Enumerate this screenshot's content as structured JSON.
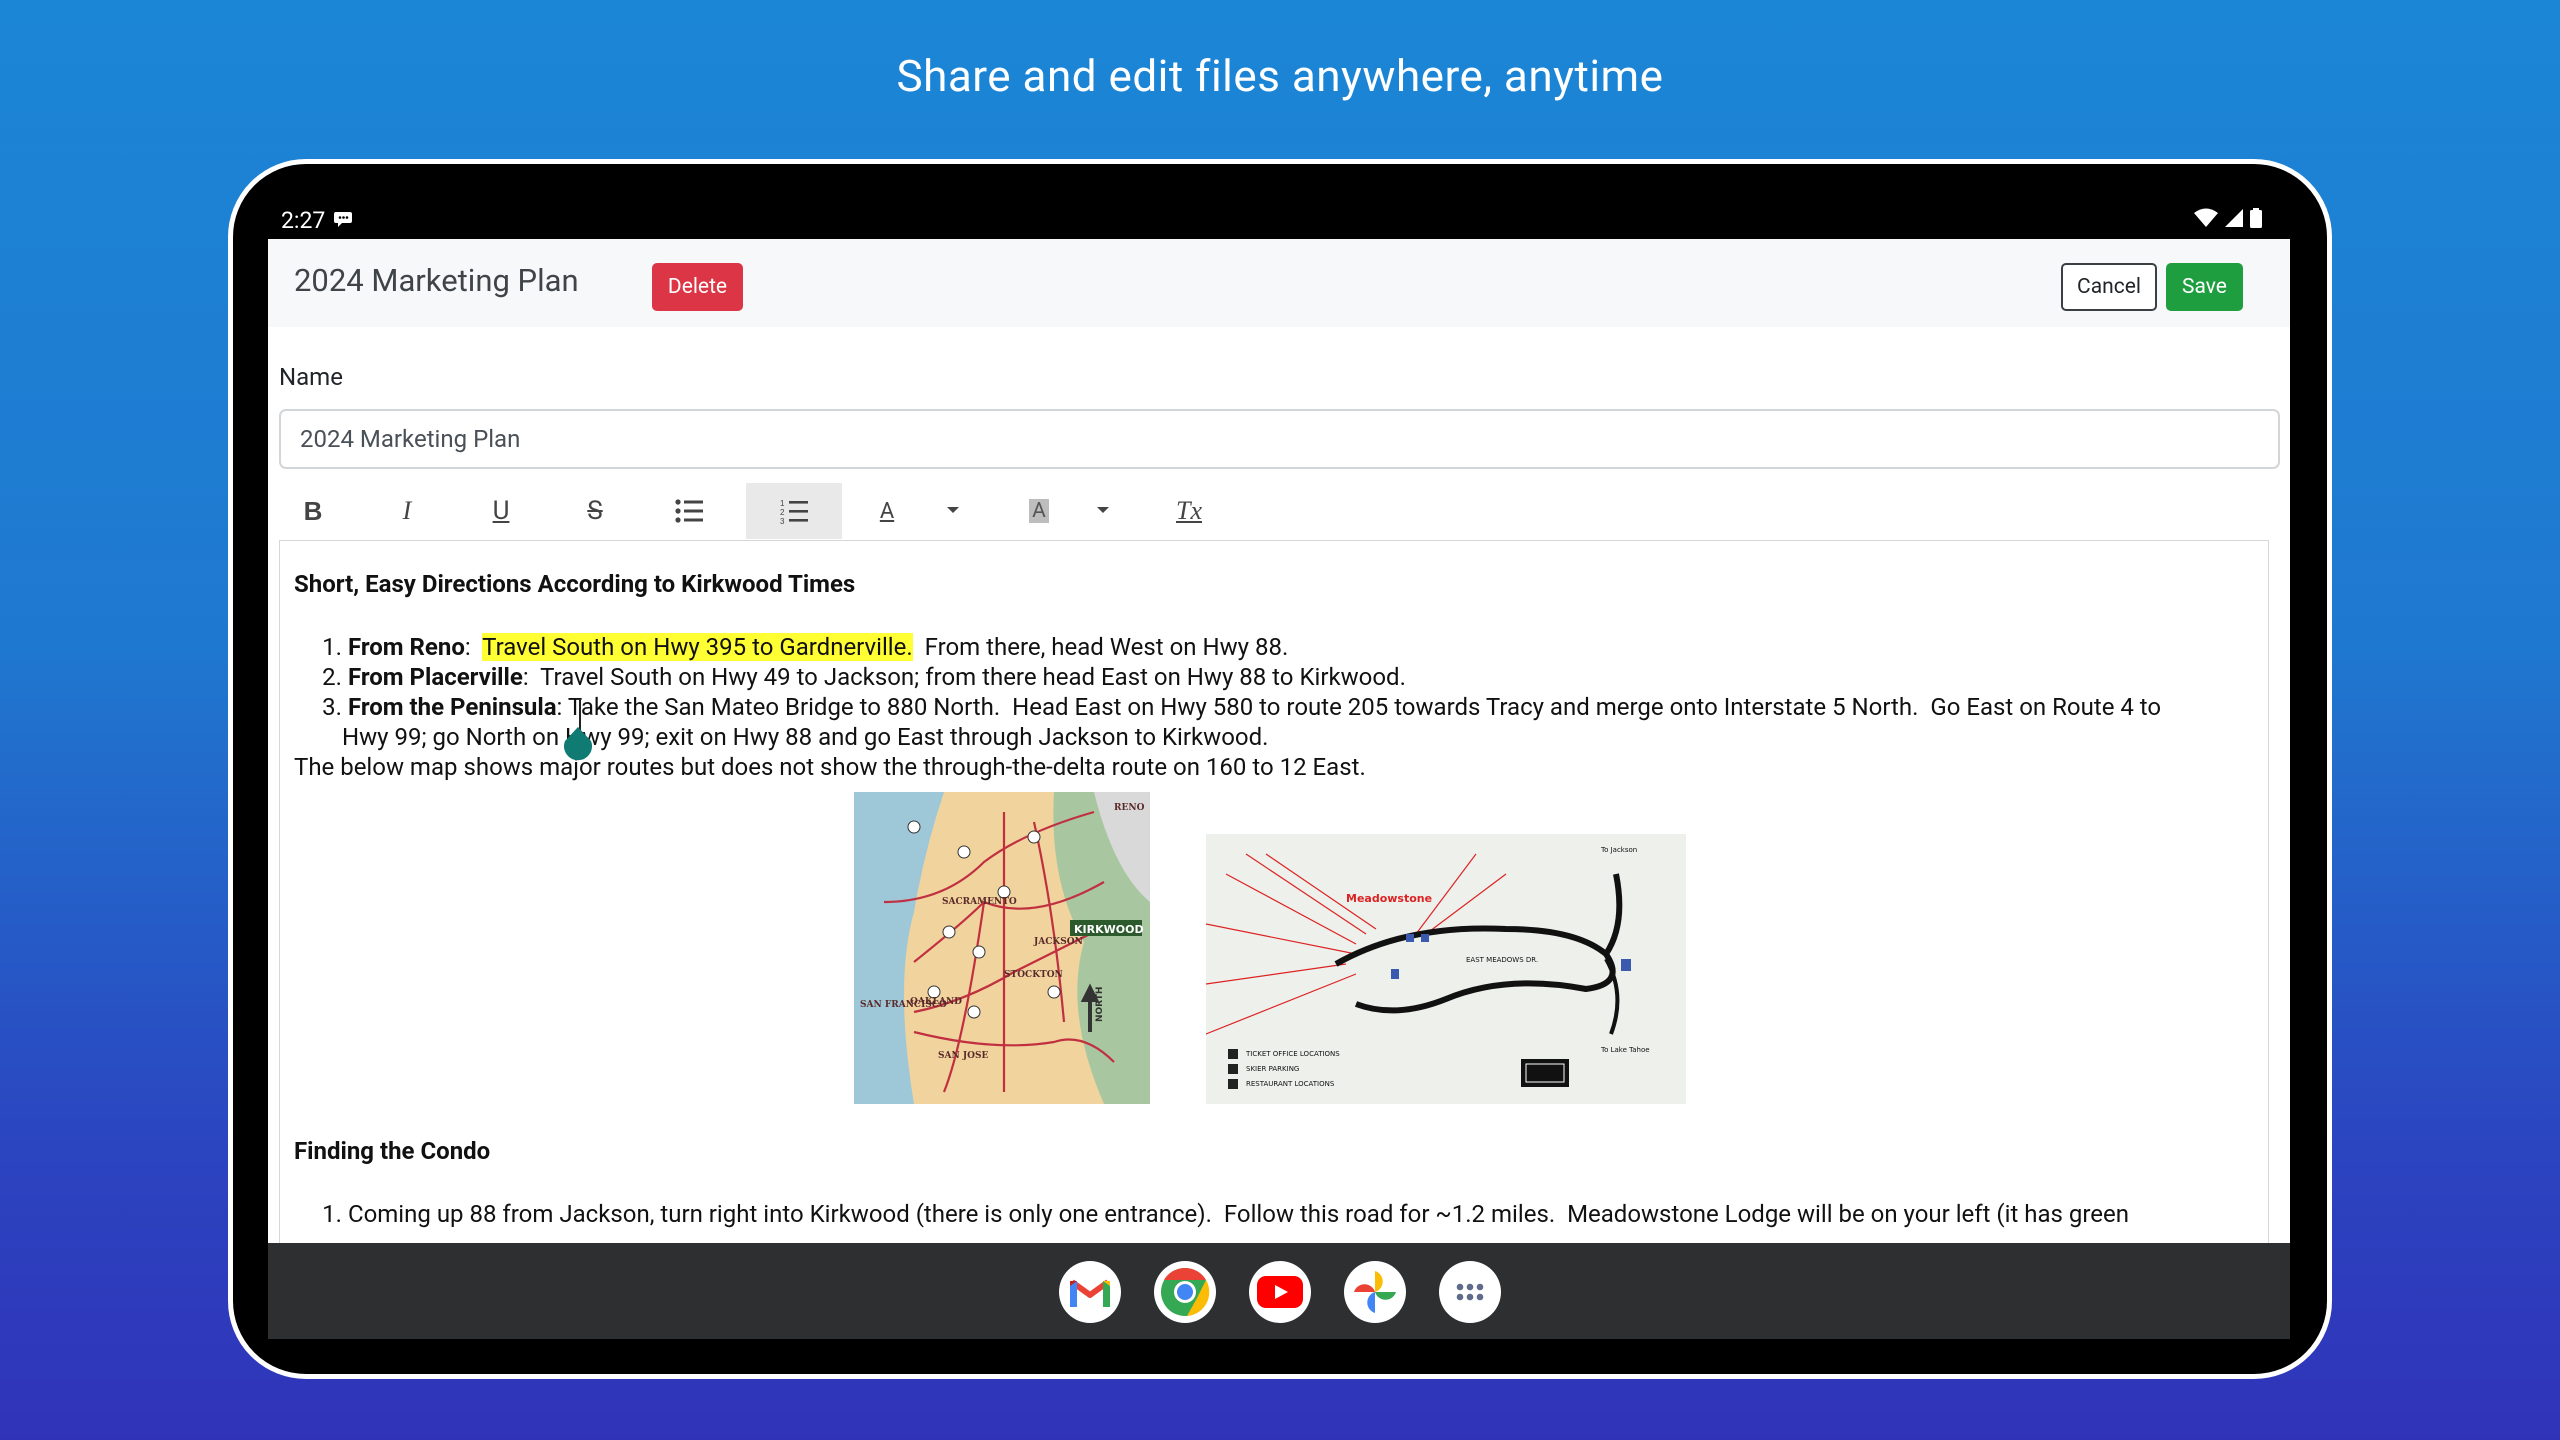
{
  "headline": "Share and edit files anywhere, anytime",
  "status": {
    "time": "2:27"
  },
  "topbar": {
    "title": "2024 Marketing Plan",
    "delete_label": "Delete",
    "cancel_label": "Cancel",
    "save_label": "Save"
  },
  "form": {
    "name_label": "Name",
    "name_value": "2024 Marketing Plan"
  },
  "toolbar": {
    "bold": "B",
    "italic": "I",
    "underline": "U",
    "strike": "S",
    "font_color": "A",
    "highlight": "A",
    "clear": "Tx"
  },
  "document": {
    "heading1": "Short, Easy Directions According to Kirkwood Times",
    "items": [
      {
        "num": "1.",
        "bold": "From Reno",
        "sep": ":  ",
        "highlight": "Travel South on Hwy 395 to Gardnerville.",
        "rest": "  From there, head West on Hwy 88."
      },
      {
        "num": "2.",
        "bold": "From Placerville",
        "sep": ":  ",
        "rest": "Travel South on Hwy 49 to Jackson; from there head East on Hwy 88 to Kirkwood."
      },
      {
        "num": "3.",
        "bold": "From the Peninsula",
        "sep": ": ",
        "rest": "Take the San Mateo Bridge to 880 North.  Head East on Hwy 580 to route 205 towards Tracy and merge onto Interstate 5 North.  Go East on Route 4 to",
        "rest2": "Hwy 99; go North on Hwy 99; exit on Hwy 88 and go East through Jackson to Kirkwood."
      }
    ],
    "paragraph": "The below map shows major routes but does not show the through-the-delta route on 160 to 12 East.",
    "heading2": "Finding the Condo",
    "item4_num": "1.",
    "item4": "Coming up 88 from Jackson, turn right into Kirkwood (there is only one entrance).  Follow this road for ~1.2 miles.  Meadowstone Lodge will be on your left (it has green"
  },
  "map1": {
    "labels": [
      "RENO",
      "SACRAMENTO",
      "JACKSON",
      "KIRKWOOD",
      "STOCKTON",
      "OAKLAND",
      "SAN FRANCISCO",
      "SAN JOSE",
      "NORTH"
    ]
  },
  "map2": {
    "labels": [
      "Meadowstone",
      "To Jackson",
      "To Lake Tahoe",
      "EAST MEADOWS DR.",
      "TICKET OFFICE LOCATIONS",
      "SKIER PARKING",
      "RESTAURANT LOCATIONS"
    ]
  },
  "colors": {
    "delete": "#dc3545",
    "save": "#1e9e3f",
    "highlight": "#ffff33"
  }
}
